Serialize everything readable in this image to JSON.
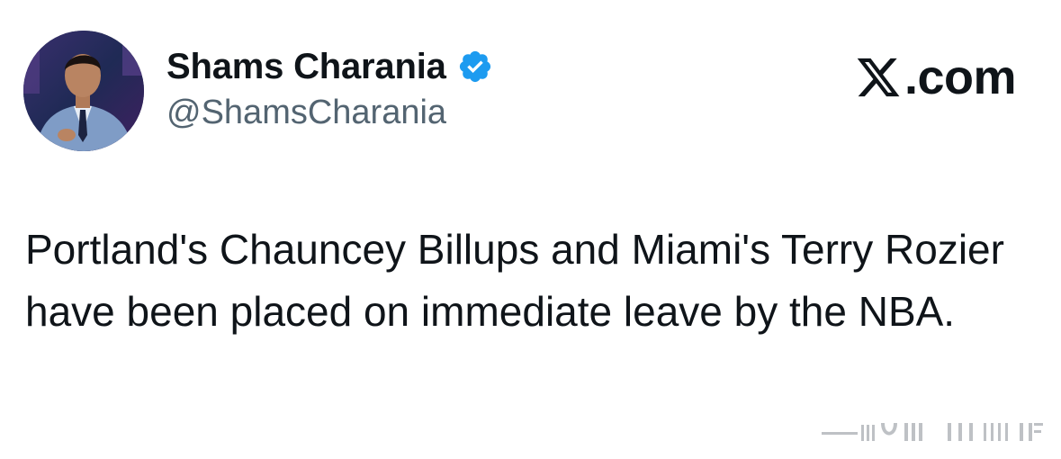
{
  "tweet": {
    "author": {
      "display_name": "Shams Charania",
      "handle": "@ShamsCharania",
      "verified": true,
      "avatar_icon": "profile-photo"
    },
    "brand": {
      "logo_icon": "x-logo-icon",
      "domain_suffix": ".com"
    },
    "text": "Portland's Chauncey Billups and Miami's Terry Rozier have been placed on immediate leave by the NBA."
  },
  "colors": {
    "text_primary": "#0f1419",
    "text_secondary": "#536471",
    "verified_blue": "#1d9bf0",
    "background": "#ffffff"
  }
}
